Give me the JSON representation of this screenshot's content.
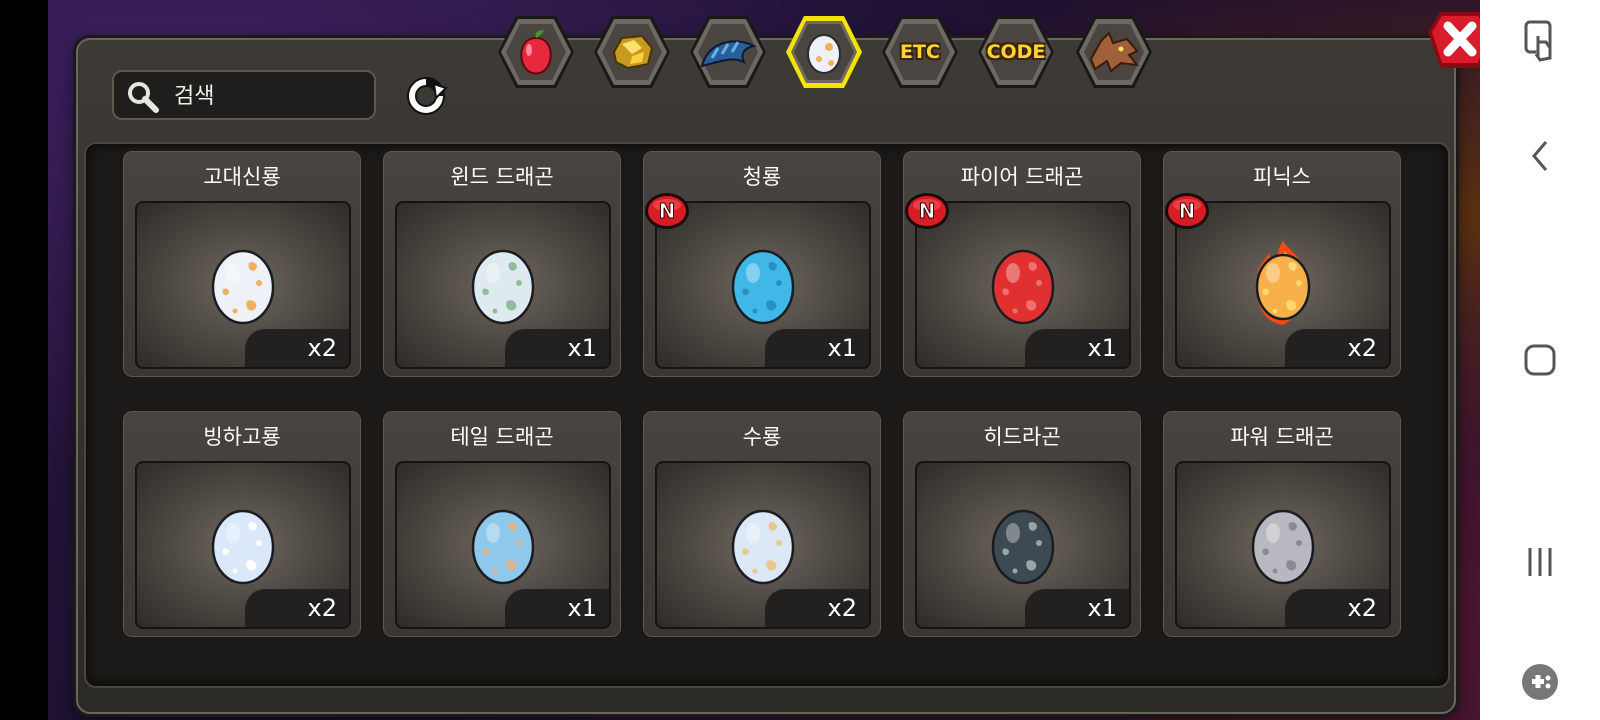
{
  "search": {
    "placeholder": "검색"
  },
  "tabs": [
    {
      "label": "",
      "icon": "fruit-icon",
      "active": false
    },
    {
      "label": "",
      "icon": "ore-icon",
      "active": false
    },
    {
      "label": "",
      "icon": "scale-icon",
      "active": false
    },
    {
      "label": "",
      "icon": "egg-icon",
      "active": true
    },
    {
      "label": "ETC",
      "icon": "",
      "active": false
    },
    {
      "label": "CODE",
      "icon": "",
      "active": false
    },
    {
      "label": "",
      "icon": "dragon-head-icon",
      "active": false
    }
  ],
  "items": [
    {
      "name": "고대신룡",
      "count": "x2",
      "new": false,
      "egg_base": "#eef2f8",
      "egg_spot": "#f0b060"
    },
    {
      "name": "윈드 드래곤",
      "count": "x1",
      "new": false,
      "egg_base": "#dfeaf0",
      "egg_spot": "#8fbf9a"
    },
    {
      "name": "청룡",
      "count": "x1",
      "new": true,
      "egg_base": "#3fb8e8",
      "egg_spot": "#2a8fc0"
    },
    {
      "name": "파이어 드래곤",
      "count": "x1",
      "new": true,
      "egg_base": "#e03030",
      "egg_spot": "#f07070"
    },
    {
      "name": "피닉스",
      "count": "x2",
      "new": true,
      "egg_base": "#f7b04a",
      "egg_spot": "#ffd870",
      "flame": true
    },
    {
      "name": "빙하고룡",
      "count": "x2",
      "new": false,
      "egg_base": "#dbe8fa",
      "egg_spot": "#ffffff"
    },
    {
      "name": "테일 드래곤",
      "count": "x1",
      "new": false,
      "egg_base": "#8ec8ea",
      "egg_spot": "#d9b48a"
    },
    {
      "name": "수룡",
      "count": "x2",
      "new": false,
      "egg_base": "#dde8f6",
      "egg_spot": "#e8c890"
    },
    {
      "name": "히드라곤",
      "count": "x1",
      "new": false,
      "egg_base": "#3e4a52",
      "egg_spot": "#9aa4aa"
    },
    {
      "name": "파워 드래곤",
      "count": "x2",
      "new": false,
      "egg_base": "#b8b8c0",
      "egg_spot": "#8a8a94"
    }
  ],
  "badge_label": "N",
  "colors": {
    "tab_active_border": "#f4e400",
    "close_red": "#d81c2c",
    "count_bg": "#23211f"
  }
}
